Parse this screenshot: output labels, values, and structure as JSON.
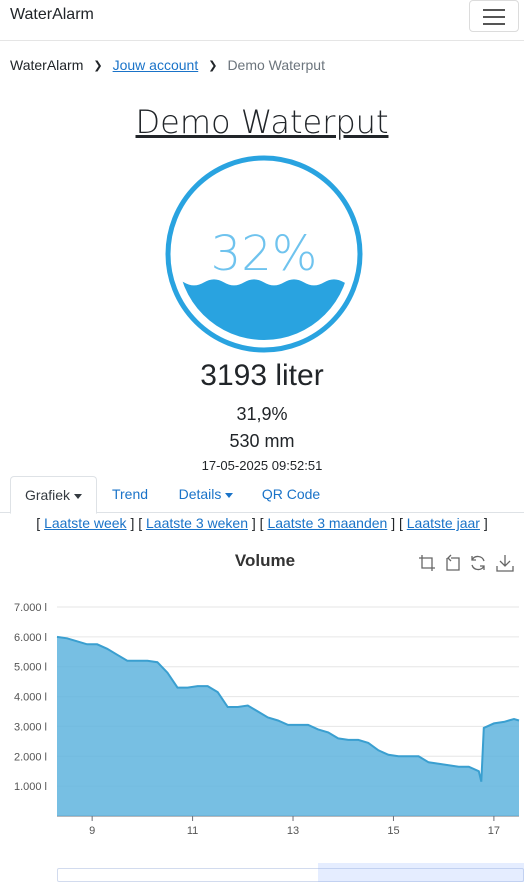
{
  "nav": {
    "brand": "WaterAlarm"
  },
  "breadcrumb": {
    "home": "WaterAlarm",
    "account": "Jouw account",
    "current": "Demo Waterput"
  },
  "title": "Demo Waterput",
  "gauge": {
    "percent_label": "32%",
    "fill_fraction": 0.319,
    "color": "#29a3e0"
  },
  "readings": {
    "liters": "3193 liter",
    "percent": "31,9%",
    "mm": "530 mm",
    "timestamp": "17-05-2025 09:52:51"
  },
  "tabs": [
    {
      "label": "Grafiek",
      "dropdown": true,
      "active": true
    },
    {
      "label": "Trend",
      "dropdown": false,
      "active": false
    },
    {
      "label": "Details",
      "dropdown": true,
      "active": false
    },
    {
      "label": "QR Code",
      "dropdown": false,
      "active": false
    }
  ],
  "ranges": [
    "Laatste week",
    "Laatste 3 weken",
    "Laatste 3 maanden",
    "Laatste jaar"
  ],
  "toolbox": [
    "zoom-icon",
    "zoom-reset-icon",
    "refresh-icon",
    "download-icon"
  ],
  "chart_data": {
    "type": "area",
    "title": "Volume",
    "xlabel": "",
    "ylabel": "",
    "x_ticks": [
      9,
      11,
      13,
      15,
      17
    ],
    "y_ticks": [
      "1.000 l",
      "2.000 l",
      "3.000 l",
      "4.000 l",
      "5.000 l",
      "6.000 l",
      "7.000 l"
    ],
    "xlim": [
      8.3,
      17.5
    ],
    "ylim": [
      0,
      7000
    ],
    "grid": true,
    "color": "#5fb4de",
    "series": [
      {
        "x": [
          8.3,
          8.5,
          8.7,
          8.9,
          9.1,
          9.3,
          9.5,
          9.7,
          9.9,
          10.1,
          10.3,
          10.5,
          10.7,
          10.9,
          11.1,
          11.3,
          11.5,
          11.7,
          11.9,
          12.1,
          12.3,
          12.5,
          12.7,
          12.9,
          13.1,
          13.3,
          13.5,
          13.7,
          13.9,
          14.1,
          14.3,
          14.5,
          14.7,
          14.9,
          15.1,
          15.3,
          15.5,
          15.7,
          15.9,
          16.1,
          16.3,
          16.5,
          16.7,
          16.75,
          16.8,
          17.0,
          17.2,
          17.4,
          17.5
        ],
        "values": [
          6000,
          5950,
          5850,
          5750,
          5750,
          5600,
          5400,
          5200,
          5200,
          5200,
          5150,
          4800,
          4300,
          4300,
          4350,
          4350,
          4150,
          3650,
          3650,
          3700,
          3500,
          3300,
          3200,
          3050,
          3050,
          3050,
          2900,
          2800,
          2600,
          2550,
          2550,
          2450,
          2200,
          2050,
          2000,
          2000,
          2000,
          1800,
          1750,
          1700,
          1650,
          1650,
          1500,
          1150,
          2950,
          3100,
          3150,
          3250,
          3200
        ]
      }
    ]
  }
}
